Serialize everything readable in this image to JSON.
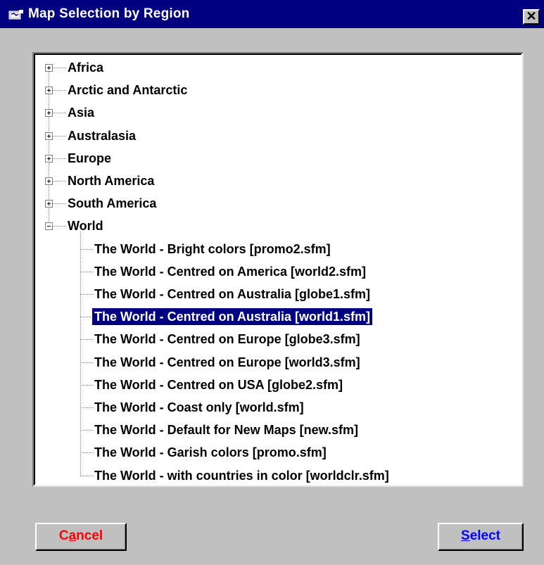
{
  "window": {
    "title": "Map Selection by Region",
    "close_glyph": "✕",
    "title_icon": "map-icon"
  },
  "tree": {
    "regions": [
      {
        "label": "Africa",
        "expanded": false
      },
      {
        "label": "Arctic and Antarctic",
        "expanded": false
      },
      {
        "label": "Asia",
        "expanded": false
      },
      {
        "label": "Australasia",
        "expanded": false
      },
      {
        "label": "Europe",
        "expanded": false
      },
      {
        "label": "North America",
        "expanded": false
      },
      {
        "label": "South America",
        "expanded": false
      },
      {
        "label": "World",
        "expanded": true,
        "children": [
          {
            "label": "The World - Bright colors [promo2.sfm]",
            "selected": false
          },
          {
            "label": "The World - Centred on America [world2.sfm]",
            "selected": false
          },
          {
            "label": "The World - Centred on Australia [globe1.sfm]",
            "selected": false
          },
          {
            "label": "The World - Centred on Australia [world1.sfm]",
            "selected": true
          },
          {
            "label": "The World - Centred on Europe [globe3.sfm]",
            "selected": false
          },
          {
            "label": "The World - Centred on Europe [world3.sfm]",
            "selected": false
          },
          {
            "label": "The World - Centred on USA [globe2.sfm]",
            "selected": false
          },
          {
            "label": "The World - Coast only [world.sfm]",
            "selected": false
          },
          {
            "label": "The World - Default for New Maps [new.sfm]",
            "selected": false
          },
          {
            "label": "The World - Garish colors [promo.sfm]",
            "selected": false
          },
          {
            "label": "The World - with countries in color [worldclr.sfm]",
            "selected": false
          }
        ]
      }
    ]
  },
  "buttons": {
    "cancel": {
      "accel": "a",
      "pre": "C",
      "post": "ncel",
      "color": "#ff0000"
    },
    "select": {
      "accel": "S",
      "pre": "",
      "post": "elect",
      "color": "#0000ff"
    }
  },
  "colors": {
    "titlebar": "#000080",
    "face": "#c0c0c0",
    "selection": "#000080"
  }
}
